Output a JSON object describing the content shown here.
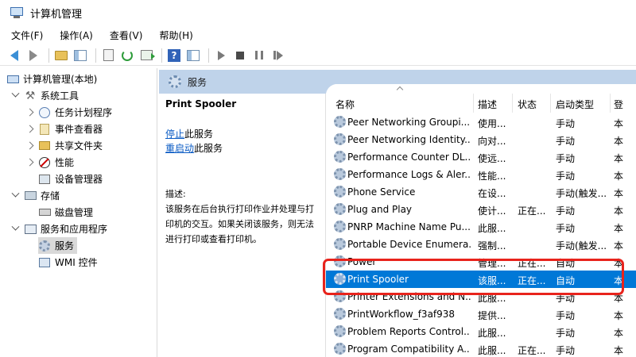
{
  "window": {
    "title": "计算机管理"
  },
  "menu": [
    "文件(F)",
    "操作(A)",
    "查看(V)",
    "帮助(H)"
  ],
  "toolbar": {
    "buttons": [
      "back-icon",
      "forward-icon",
      "up-folder-icon",
      "console-tree-icon",
      "properties-icon",
      "refresh-icon",
      "export-icon",
      "help-icon",
      "show-hide-pane-icon",
      "start-service-icon",
      "stop-service-icon",
      "pause-service-icon",
      "restart-service-icon"
    ],
    "help_glyph": "?"
  },
  "tree": {
    "root": "计算机管理(本地)",
    "system_tools": "系统工具",
    "task_scheduler": "任务计划程序",
    "event_viewer": "事件查看器",
    "shared_folders": "共享文件夹",
    "performance": "性能",
    "device_manager": "设备管理器",
    "storage": "存储",
    "disk_management": "磁盘管理",
    "services_apps": "服务和应用程序",
    "services": "服务",
    "wmi": "WMI 控件"
  },
  "pane_header": "服务",
  "details": {
    "service_name": "Print Spooler",
    "stop_link": "停止",
    "stop_suffix": "此服务",
    "restart_link": "重启动",
    "restart_suffix": "此服务",
    "desc_label": "描述:",
    "desc_text": "该服务在后台执行打印作业并处理与打印机的交互。如果关闭该服务，则无法进行打印或查看打印机。"
  },
  "columns": {
    "name": "名称",
    "desc": "描述",
    "status": "状态",
    "startup": "启动类型",
    "logon": "登"
  },
  "services": [
    {
      "name": "Peer Networking Groupi...",
      "desc": "使用...",
      "status": "",
      "startup": "手动",
      "logon": "本"
    },
    {
      "name": "Peer Networking Identity...",
      "desc": "向对...",
      "status": "",
      "startup": "手动",
      "logon": "本"
    },
    {
      "name": "Performance Counter DL...",
      "desc": "使远...",
      "status": "",
      "startup": "手动",
      "logon": "本"
    },
    {
      "name": "Performance Logs & Aler...",
      "desc": "性能...",
      "status": "",
      "startup": "手动",
      "logon": "本"
    },
    {
      "name": "Phone Service",
      "desc": "在设...",
      "status": "",
      "startup": "手动(触发...",
      "logon": "本"
    },
    {
      "name": "Plug and Play",
      "desc": "使计...",
      "status": "正在...",
      "startup": "手动",
      "logon": "本"
    },
    {
      "name": "PNRP Machine Name Pu...",
      "desc": "此服...",
      "status": "",
      "startup": "手动",
      "logon": "本"
    },
    {
      "name": "Portable Device Enumera...",
      "desc": "强制...",
      "status": "",
      "startup": "手动(触发...",
      "logon": "本"
    },
    {
      "name": "Power",
      "desc": "管理...",
      "status": "正在...",
      "startup": "自动",
      "logon": "本"
    },
    {
      "name": "Print Spooler",
      "desc": "该服...",
      "status": "正在...",
      "startup": "自动",
      "logon": "本"
    },
    {
      "name": "Printer Extensions and N...",
      "desc": "此服...",
      "status": "",
      "startup": "手动",
      "logon": "本"
    },
    {
      "name": "PrintWorkflow_f3af938",
      "desc": "提供...",
      "status": "",
      "startup": "手动",
      "logon": "本"
    },
    {
      "name": "Problem Reports Control...",
      "desc": "此服...",
      "status": "",
      "startup": "手动",
      "logon": "本"
    },
    {
      "name": "Program Compatibility A...",
      "desc": "此服...",
      "status": "正在...",
      "startup": "手动",
      "logon": "本"
    }
  ],
  "selected_service": "Print Spooler",
  "colors": {
    "selection": "#0078d7",
    "pane_header": "#bfd3ea",
    "highlight": "#e8231c",
    "link": "#0a5bc4"
  }
}
